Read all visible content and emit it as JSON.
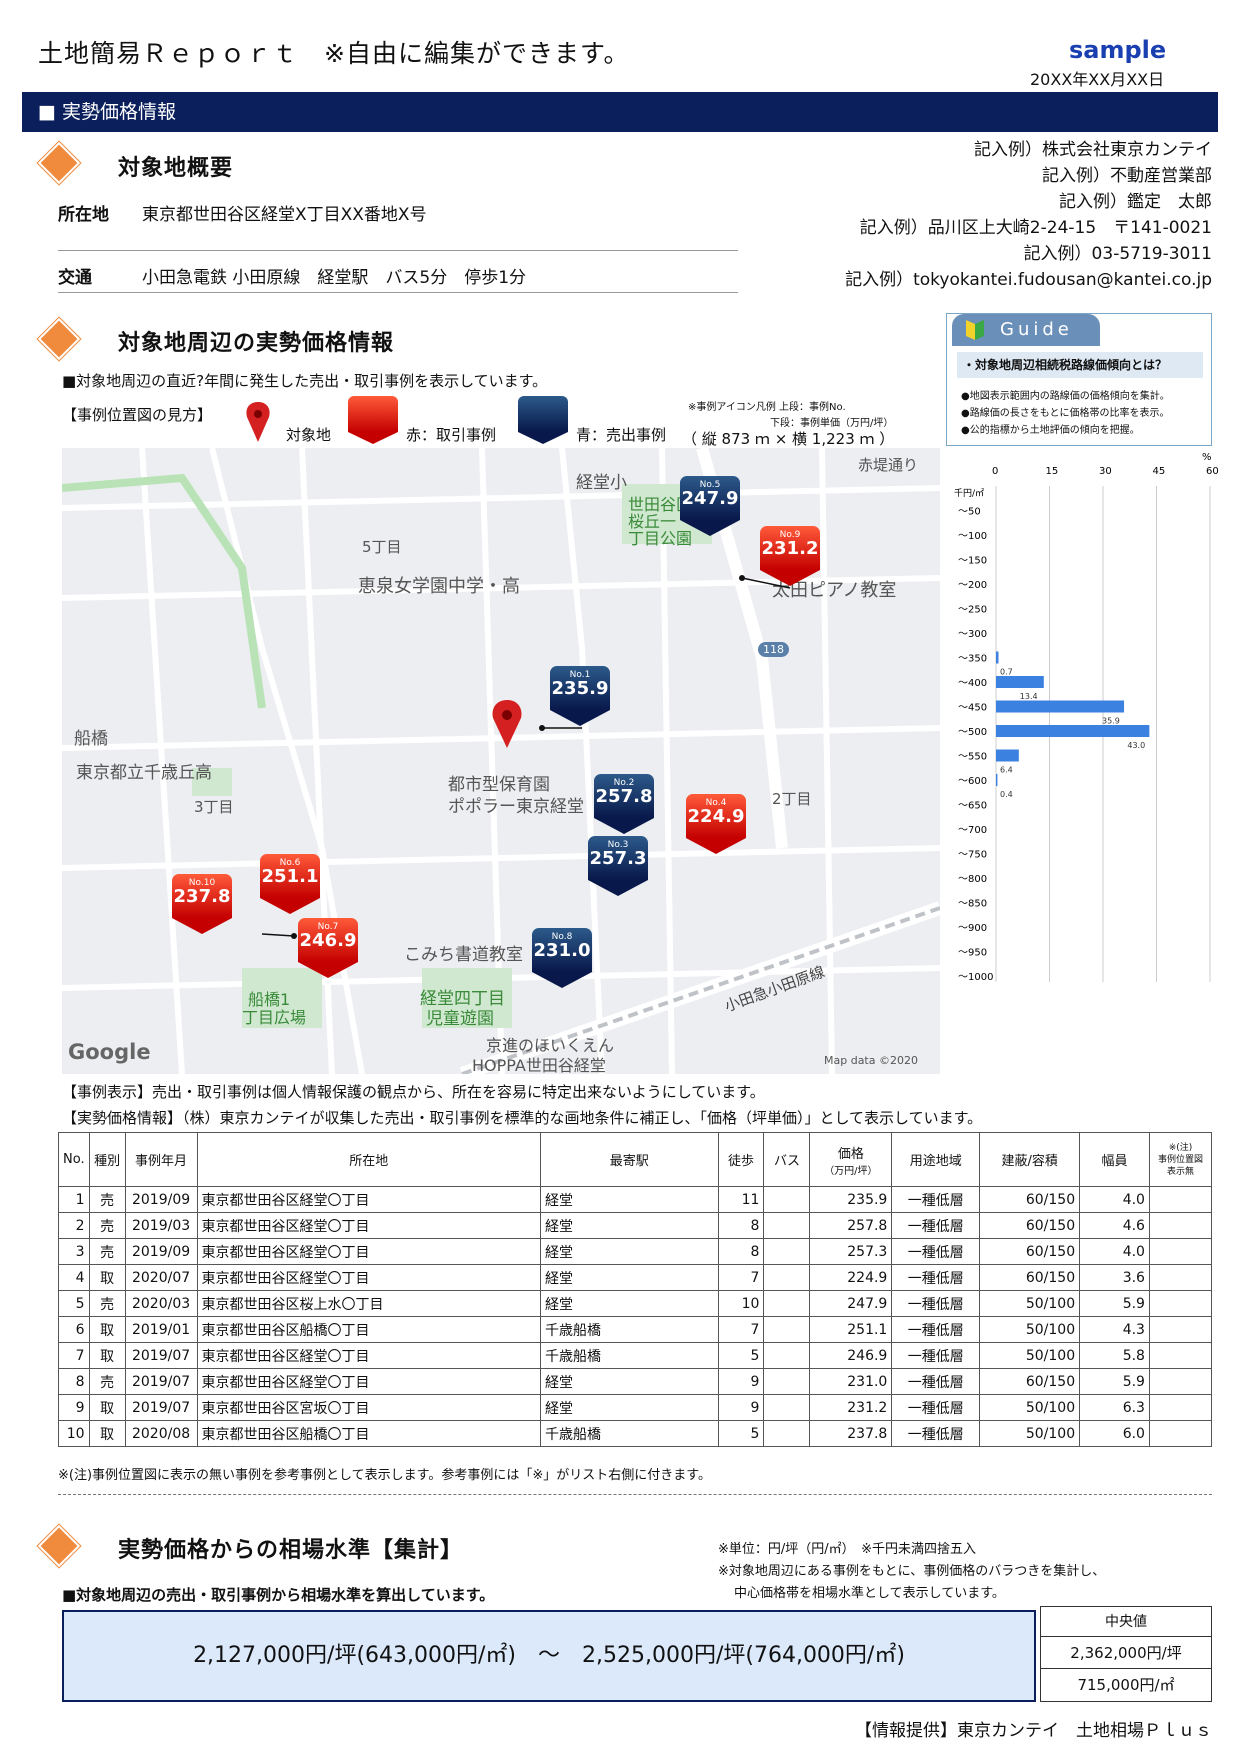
{
  "header": {
    "title": "土地簡易Ｒｅｐｏｒｔ　※自由に編集ができます。",
    "sample": "sample",
    "date": "20XX年XX月XX日"
  },
  "section_bar": "■ 実勢価格情報",
  "overview": {
    "heading": "対象地概要",
    "address_label": "所在地",
    "address": "東京都世田谷区経堂X丁目XX番地X号",
    "traffic_label": "交通",
    "traffic": "小田急電鉄 小田原線　経堂駅　バス5分　停歩1分"
  },
  "company": {
    "line1": "記入例）株式会社東京カンテイ",
    "line2": "記入例）不動産営業部",
    "line3": "記入例）鑑定　太郎",
    "line4": "記入例）品川区上大崎2-24-15　〒141-0021",
    "line5": "記入例）03-5719-3011",
    "line6": "記入例）tokyokantei.fudousan@kantei.co.jp"
  },
  "surround": {
    "heading": "対象地周辺の実勢価格情報",
    "sub": "■対象地周辺の直近?年間に発生した売出・取引事例を表示しています。",
    "legend_label": "【事例位置図の見方】",
    "legend_target": "対象地",
    "legend_red": "赤：取引事例",
    "legend_blue": "青：売出事例",
    "icon_note1": "※事例アイコン凡例 上段：事例No.",
    "icon_note2": "下段：事例単価（万円/坪）",
    "map_scale": "（ 縦 873 ｍ × 横 1,223 ｍ ）"
  },
  "guide": {
    "tab": "Guide",
    "title": "・対象地周辺相続税路線価傾向とは？",
    "b1": "●地図表示範囲内の路線価の価格傾向を集計。",
    "b2": "●路線価の長さをもとに価格帯の比率を表示。",
    "b3": "●公的指標から土地評価の傾向を把握。"
  },
  "map": {
    "labels": {
      "kyodo_sho": "経堂小",
      "akatsutsumi": "赤堤通り",
      "chome5": "5丁目",
      "keisen": "恵泉女学園中学・高",
      "ohta": "太田ピアノ教室",
      "r118": "118",
      "funabashi": "船橋",
      "chitose": "東京都立千歳丘高",
      "chome3": "3丁目",
      "hoikuen": "都市型保育園",
      "popura": "ポポラー東京経堂",
      "chome2": "2丁目",
      "komichi": "こみち書道教室",
      "funabashi1a": "船橋1",
      "funabashi1b": "丁目広場",
      "kyodo4a": "経堂四丁目",
      "kyodo4b": "児童遊園",
      "odakyu": "小田急小田原線",
      "kyoshin": "京進のほいくえん",
      "hoppa": "HOPPA世田谷経堂",
      "google": "Google",
      "mapdata": "Map data ©2020",
      "park1": "世田谷区立",
      "park2": "桜丘一",
      "park3": "丁目公園"
    },
    "pins": [
      {
        "no": "No.1",
        "val": "235.9",
        "color": "blue"
      },
      {
        "no": "No.2",
        "val": "257.8",
        "color": "blue"
      },
      {
        "no": "No.3",
        "val": "257.3",
        "color": "blue"
      },
      {
        "no": "No.4",
        "val": "224.9",
        "color": "red"
      },
      {
        "no": "No.5",
        "val": "247.9",
        "color": "blue"
      },
      {
        "no": "No.6",
        "val": "251.1",
        "color": "red"
      },
      {
        "no": "No.7",
        "val": "246.9",
        "color": "red"
      },
      {
        "no": "No.8",
        "val": "231.0",
        "color": "blue"
      },
      {
        "no": "No.9",
        "val": "231.2",
        "color": "red"
      },
      {
        "no": "No.10",
        "val": "237.8",
        "color": "red"
      }
    ]
  },
  "chart_data": {
    "type": "bar",
    "orientation": "horizontal",
    "xlabel": "%",
    "ylabel": "千円/㎡",
    "xlim": [
      0,
      60
    ],
    "xticks": [
      "0",
      "15",
      "30",
      "45",
      "60"
    ],
    "categories": [
      "～50",
      "～100",
      "～150",
      "～200",
      "～250",
      "～300",
      "～350",
      "～400",
      "～450",
      "～500",
      "～550",
      "～600",
      "～650",
      "～700",
      "～750",
      "～800",
      "～850",
      "～900",
      "～950",
      "～1000"
    ],
    "values": [
      null,
      null,
      null,
      null,
      null,
      null,
      0.7,
      13.4,
      35.9,
      43.0,
      6.4,
      0.4,
      null,
      null,
      null,
      null,
      null,
      null,
      null,
      null
    ],
    "value_labels": [
      "",
      "",
      "",
      "",
      "",
      "",
      "0.7",
      "13.4",
      "35.9",
      "43.0",
      "6.4",
      "0.4",
      "",
      "",
      "",
      "",
      "",
      "",
      "",
      ""
    ],
    "color": "#3b82e0"
  },
  "notes": {
    "n1": "【事例表示】売出・取引事例は個人情報保護の観点から、所在を容易に特定出来ないようにしています。",
    "n2": "【実勢価格情報】（株）東京カンテイが収集した売出・取引事例を標準的な画地条件に補正し、「価格（坪単価）」として表示しています。"
  },
  "table": {
    "headers": {
      "no": "No.",
      "kind": "種別",
      "date": "事例年月",
      "addr": "所在地",
      "station": "最寄駅",
      "walk": "徒歩",
      "bus": "バス",
      "price1": "価格",
      "price2": "（万円/坪）",
      "zone": "用途地域",
      "ratio": "建蔽/容積",
      "width": "幅員",
      "note1": "※(注)",
      "note2": "事例位置図",
      "note3": "表示無"
    },
    "rows": [
      [
        "1",
        "売",
        "2019/09",
        "東京都世田谷区経堂〇丁目",
        "経堂",
        "11",
        "",
        "235.9",
        "一種低層",
        "60/150",
        "4.0",
        ""
      ],
      [
        "2",
        "売",
        "2019/03",
        "東京都世田谷区経堂〇丁目",
        "経堂",
        "8",
        "",
        "257.8",
        "一種低層",
        "60/150",
        "4.6",
        ""
      ],
      [
        "3",
        "売",
        "2019/09",
        "東京都世田谷区経堂〇丁目",
        "経堂",
        "8",
        "",
        "257.3",
        "一種低層",
        "60/150",
        "4.0",
        ""
      ],
      [
        "4",
        "取",
        "2020/07",
        "東京都世田谷区経堂〇丁目",
        "経堂",
        "7",
        "",
        "224.9",
        "一種低層",
        "60/150",
        "3.6",
        ""
      ],
      [
        "5",
        "売",
        "2020/03",
        "東京都世田谷区桜上水〇丁目",
        "経堂",
        "10",
        "",
        "247.9",
        "一種低層",
        "50/100",
        "5.9",
        ""
      ],
      [
        "6",
        "取",
        "2019/01",
        "東京都世田谷区船橋〇丁目",
        "千歳船橋",
        "7",
        "",
        "251.1",
        "一種低層",
        "50/100",
        "4.3",
        ""
      ],
      [
        "7",
        "取",
        "2019/07",
        "東京都世田谷区経堂〇丁目",
        "千歳船橋",
        "5",
        "",
        "246.9",
        "一種低層",
        "50/100",
        "5.8",
        ""
      ],
      [
        "8",
        "売",
        "2019/07",
        "東京都世田谷区経堂〇丁目",
        "経堂",
        "9",
        "",
        "231.0",
        "一種低層",
        "60/150",
        "5.9",
        ""
      ],
      [
        "9",
        "取",
        "2019/07",
        "東京都世田谷区宮坂〇丁目",
        "経堂",
        "9",
        "",
        "231.2",
        "一種低層",
        "50/100",
        "6.3",
        ""
      ],
      [
        "10",
        "取",
        "2020/08",
        "東京都世田谷区船橋〇丁目",
        "千歳船橋",
        "5",
        "",
        "237.8",
        "一種低層",
        "50/100",
        "6.0",
        ""
      ]
    ],
    "footnote": "※(注)事例位置図に表示の無い事例を参考事例として表示します。参考事例には「※」がリスト右側に付きます。"
  },
  "summary": {
    "heading": "実勢価格からの相場水準【集計】",
    "sub": "■対象地周辺の売出・取引事例から相場水準を算出しています。",
    "unit_note": "※単位：円/坪（円/㎡）　※千円未満四捨五入",
    "note2": "※対象地周辺にある事例をもとに、事例価格のバラつきを集計し、",
    "note3": "中心価格帯を相場水準として表示しています。",
    "range": "2,127,000円/坪(643,000円/㎡)　～　2,525,000円/坪(764,000円/㎡)",
    "median_label": "中央値",
    "median_tsubo": "2,362,000円/坪",
    "median_m2": "715,000円/㎡"
  },
  "footer": "【情報提供】東京カンテイ　土地相場Ｐｌｕｓ"
}
